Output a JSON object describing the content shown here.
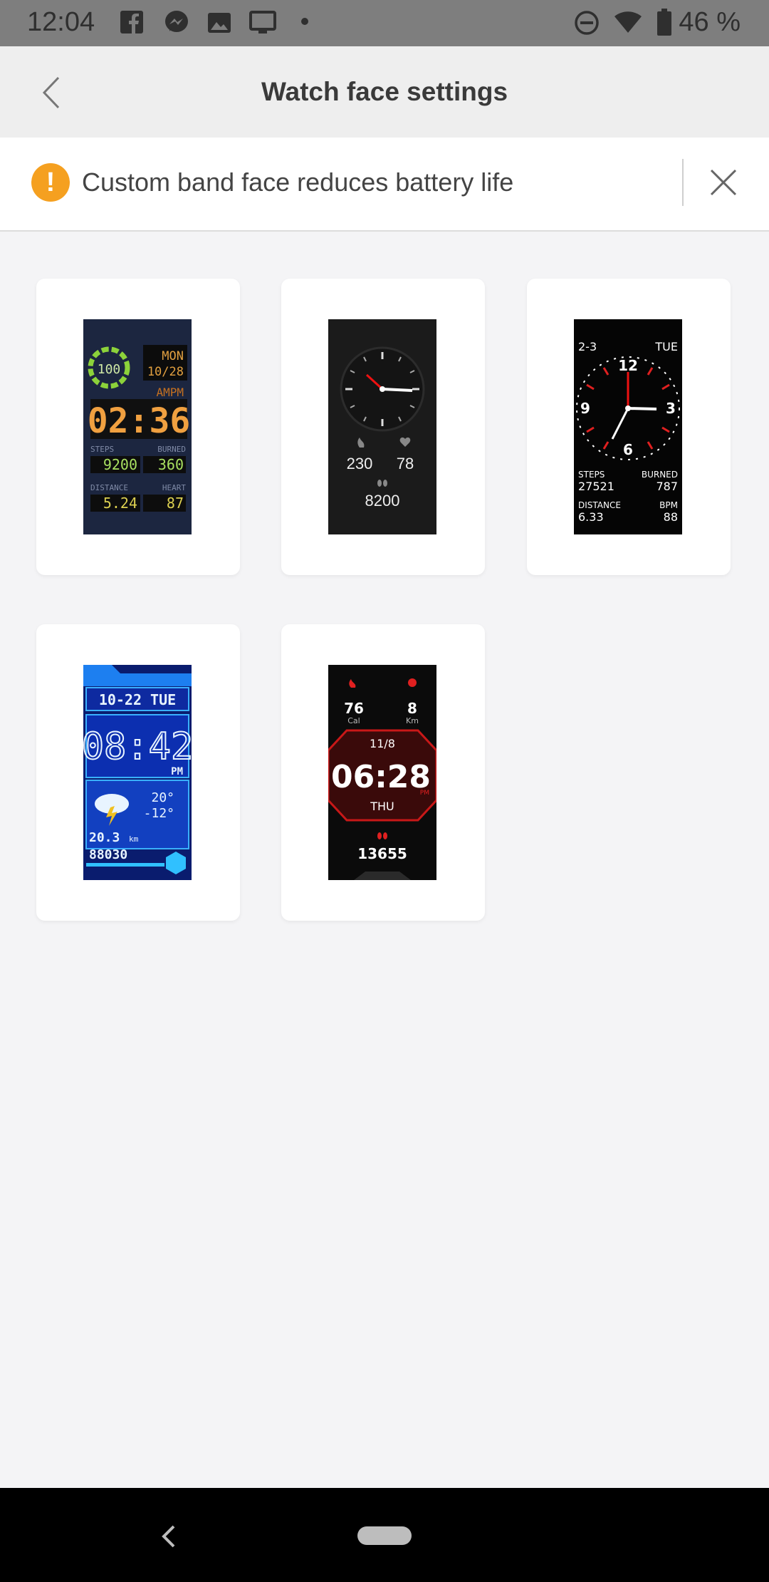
{
  "status_bar": {
    "time": "12:04",
    "battery_percent": "46 %",
    "icons": [
      "facebook-icon",
      "messenger-icon",
      "image-icon",
      "monitor-icon",
      "dot-icon",
      "dnd-icon",
      "wifi-icon",
      "battery-icon"
    ]
  },
  "header": {
    "title": "Watch face settings",
    "back_icon": "chevron-left-icon"
  },
  "banner": {
    "icon": "warning-icon",
    "warning_symbol": "!",
    "message": "Custom band face reduces battery life",
    "close_icon": "close-icon",
    "accent_color": "#f5a020"
  },
  "faces": [
    {
      "name": "digital-orange",
      "ring_value": "100",
      "day": "MON",
      "date": "10/28",
      "ampm": "AMPM",
      "time": "02:36",
      "steps_label": "STEPS",
      "steps": "9200",
      "burned_label": "BURNED",
      "burned": "360",
      "distance_label": "DISTANCE",
      "distance": "5.24",
      "heart_label": "HEART",
      "heart": "87"
    },
    {
      "name": "analog-dark",
      "calories": "230",
      "heart": "78",
      "steps": "8200"
    },
    {
      "name": "analog-red",
      "date": "2-3",
      "day": "TUE",
      "numerals": [
        "12",
        "3",
        "6",
        "9"
      ],
      "steps_label": "STEPS",
      "steps": "27521",
      "burned_label": "BURNED",
      "burned": "787",
      "distance_label": "DISTANCE",
      "distance": "6.33",
      "bpm_label": "BPM",
      "bpm": "88"
    },
    {
      "name": "digital-blue",
      "date": "10-22 TUE",
      "time": "08:42",
      "ampm": "PM",
      "temp_high": "20°",
      "temp_low": "-12°",
      "distance": "20.3",
      "distance_unit": "km",
      "steps": "88030"
    },
    {
      "name": "digital-red",
      "calories": "76",
      "calories_unit": "Cal",
      "km": "8",
      "km_unit": "Km",
      "date": "11/8",
      "time": "06:28",
      "ampm": "PM",
      "day": "THU",
      "steps": "13655"
    }
  ],
  "nav_bar": {
    "back_icon": "nav-back-icon",
    "home_icon": "home-pill-icon"
  }
}
